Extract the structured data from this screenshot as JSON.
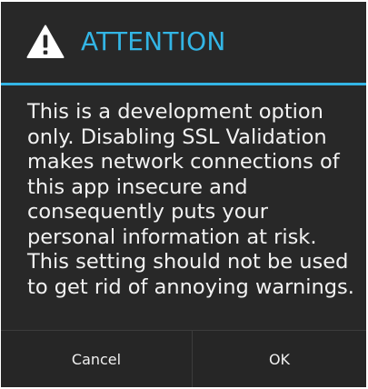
{
  "dialog": {
    "title": "ATTENTION",
    "icon": "warning-icon",
    "message": "This is a development option only. Disabling SSL Validation makes network connections of this app insecure and consequently puts your personal information at risk. This setting should not be used to get rid of annoying warnings.",
    "accent_color": "#33b5e5",
    "background_color": "#282828"
  },
  "buttons": {
    "cancel_label": "Cancel",
    "ok_label": "OK"
  }
}
